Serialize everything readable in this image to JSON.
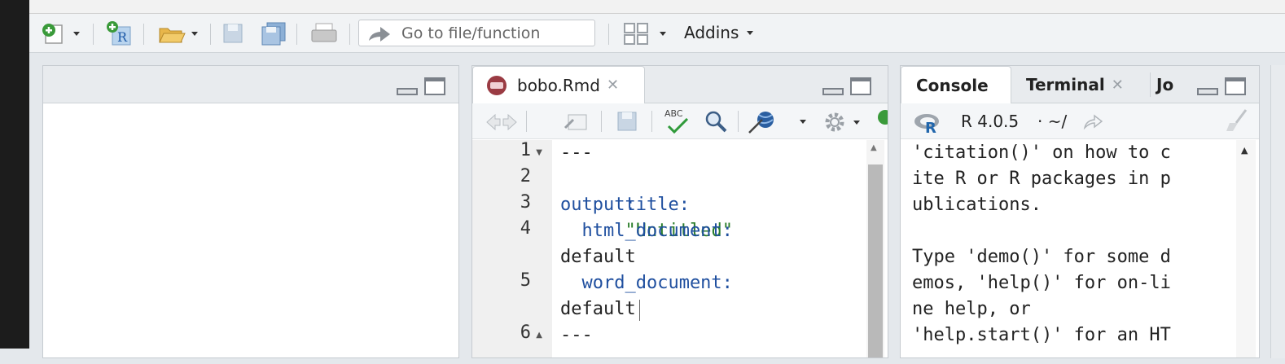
{
  "toolbar": {
    "goto_placeholder": "Go to file/function",
    "addins_label": "Addins"
  },
  "panes": {
    "left": {},
    "editor": {
      "tab_label": "bobo.Rmd",
      "line_numbers": [
        "1",
        "2",
        "3",
        "4",
        "5",
        "6"
      ],
      "code": {
        "l1": "---",
        "l2_key": "title:",
        "l2_val": "\"Untitled\"",
        "l3": "output:",
        "l4_key": "  html_document:",
        "l4_wrap": "default",
        "l5_key": "  word_document:",
        "l5_wrap": "default",
        "l6": "---"
      },
      "toolbar_labels": {
        "spellcheck": "ABC"
      }
    },
    "console": {
      "tabs": [
        "Console",
        "Terminal",
        "Jo"
      ],
      "r_version": "R 4.0.5",
      "path": "· ~/",
      "lines": [
        "'citation()' on how to c",
        "ite R or R packages in p",
        "ublications.",
        "",
        "Type 'demo()' for some d",
        "emos, 'help()' for on-li",
        "ne help, or",
        "'help.start()' for an HT"
      ]
    }
  },
  "colors": {
    "keyword": "#1f4f9f",
    "string": "#2a7d2a",
    "background": "#e4e8ec"
  }
}
